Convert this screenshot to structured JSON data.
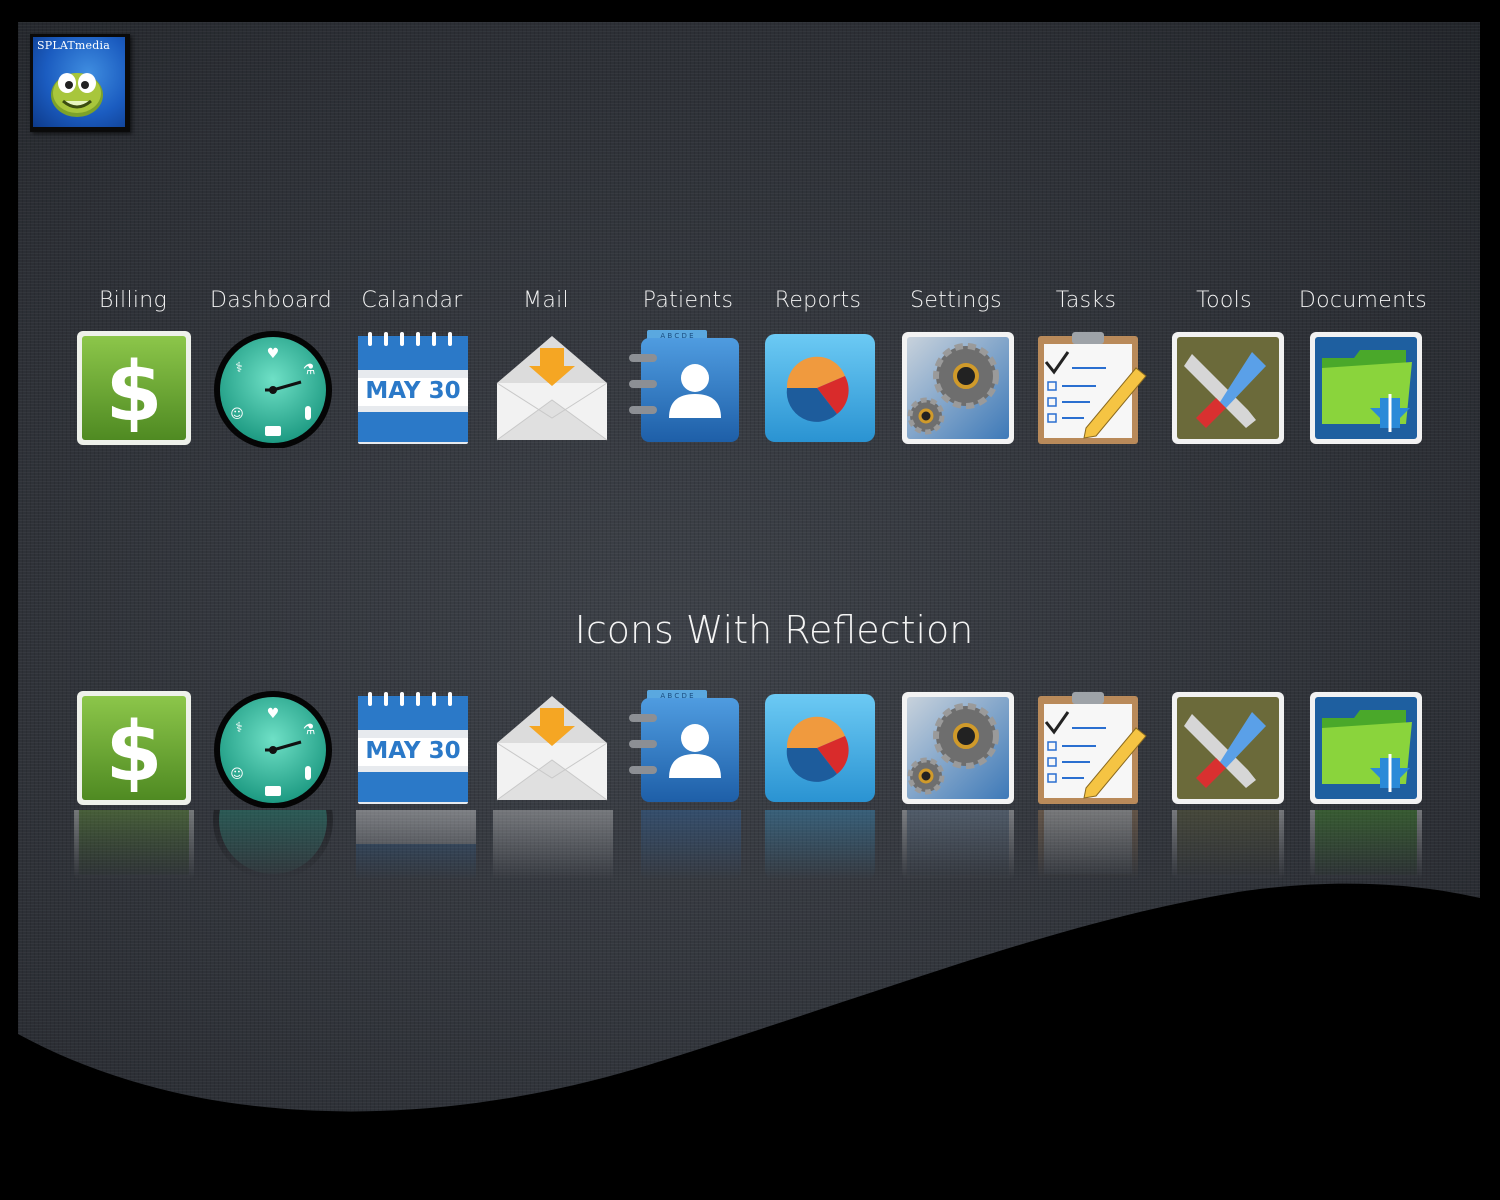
{
  "logo": {
    "brand_text": "SPLATmedia"
  },
  "heading": "Icons With Reflection",
  "calendar_text": "MAY 30",
  "patients_tab_letters": "A B C D E",
  "icons": [
    {
      "label": "Billing",
      "icon": "dollar-icon"
    },
    {
      "label": "Dashboard",
      "icon": "medical-clock-icon"
    },
    {
      "label": "Calandar",
      "icon": "calendar-icon"
    },
    {
      "label": "Mail",
      "icon": "mail-icon"
    },
    {
      "label": "Patients",
      "icon": "address-book-icon"
    },
    {
      "label": "Reports",
      "icon": "pie-chart-icon"
    },
    {
      "label": "Settings",
      "icon": "gears-icon"
    },
    {
      "label": "Tasks",
      "icon": "clipboard-checklist-icon"
    },
    {
      "label": "Tools",
      "icon": "wrench-screwdriver-icon"
    },
    {
      "label": "Documents",
      "icon": "medical-folder-icon"
    }
  ],
  "colors": {
    "background": "#33373d",
    "wave": "#000000",
    "text": "#f2f2f2",
    "billing_green": "#6aa530",
    "clock_teal": "#2aa890",
    "calendar_blue": "#2b79c8",
    "reports_blue": "#49b0e6"
  }
}
